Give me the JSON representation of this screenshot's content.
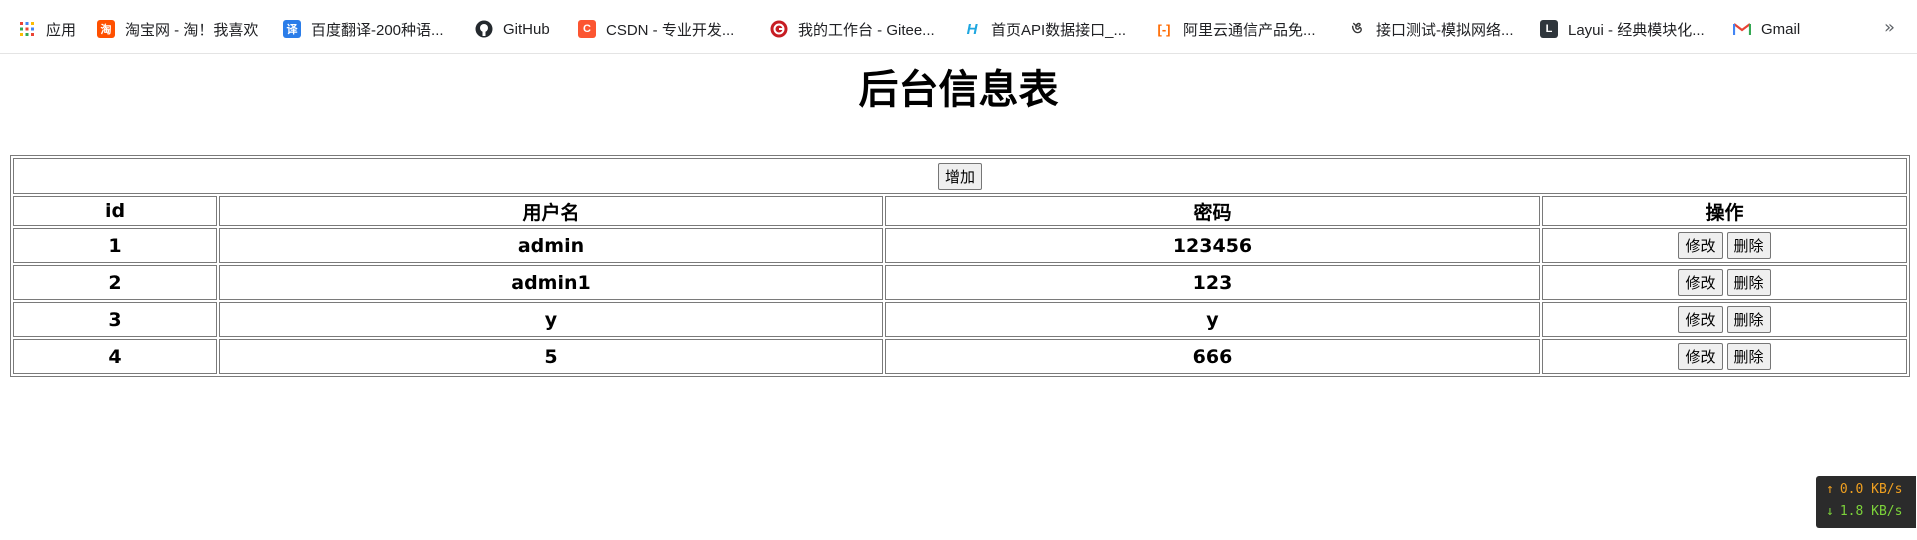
{
  "bookmarks": [
    {
      "label": "应用",
      "icon": "apps-grid-icon",
      "color": "#4285f4"
    },
    {
      "label": "淘宝网 - 淘！我喜欢",
      "icon": "taobao-icon",
      "color": "#ff5000"
    },
    {
      "label": "百度翻译-200种语...",
      "icon": "baidu-translate-icon",
      "color": "#2b7de9"
    },
    {
      "label": "GitHub",
      "icon": "github-icon",
      "color": "#24292e"
    },
    {
      "label": "CSDN - 专业开发...",
      "icon": "csdn-icon",
      "color": "#fc5531"
    },
    {
      "label": "我的工作台 - Gitee...",
      "icon": "gitee-icon",
      "color": "#c71d23"
    },
    {
      "label": "首页API数据接口_...",
      "icon": "api-icon",
      "color": "#1fa7e0"
    },
    {
      "label": "阿里云通信产品免...",
      "icon": "aliyun-icon",
      "color": "#ff6a00"
    },
    {
      "label": "接口测试-模拟网络...",
      "icon": "interface-test-icon",
      "color": "#333333"
    },
    {
      "label": "Layui - 经典模块化...",
      "icon": "layui-icon",
      "color": "#2f363c"
    },
    {
      "label": "Gmail",
      "icon": "gmail-icon",
      "color": "#ea4335"
    }
  ],
  "bookmarks_more": "»",
  "page": {
    "title": "后台信息表"
  },
  "table": {
    "add_label": "增加",
    "headers": [
      "id",
      "用户名",
      "密码",
      "操作"
    ],
    "rows": [
      {
        "id": "1",
        "username": "admin",
        "password": "123456"
      },
      {
        "id": "2",
        "username": "admin1",
        "password": "123"
      },
      {
        "id": "3",
        "username": "y",
        "password": "y"
      },
      {
        "id": "4",
        "username": "5",
        "password": "666"
      }
    ],
    "edit_label": "修改",
    "delete_label": "删除"
  },
  "netspeed": {
    "up_arrow": "↑",
    "up": "0.0 KB/s",
    "down_arrow": "↓",
    "down": "1.8 KB/s",
    "up_color": "#f0a020",
    "down_color": "#7cd33a"
  }
}
